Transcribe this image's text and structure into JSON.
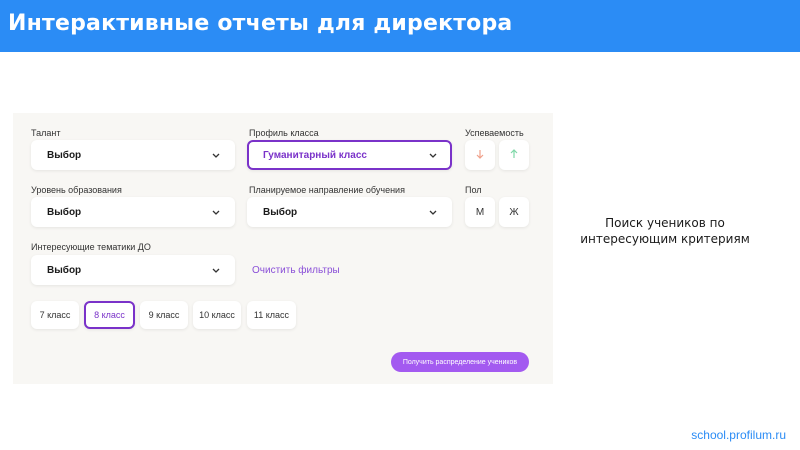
{
  "slide": {
    "title": "Интерактивные отчеты для директора",
    "caption_line1": "Поиск учеников по",
    "caption_line2": "интересующим критериям",
    "footer_url": "school.profilum.ru"
  },
  "colors": {
    "header": "#2b8cf5",
    "accent": "#7a32c9",
    "button": "#a35af0",
    "arrow_down": "#f0a08a",
    "arrow_up": "#7fd8a8"
  },
  "filters": {
    "talent": {
      "label": "Талант",
      "value": "Выбор"
    },
    "profile": {
      "label": "Профиль класса",
      "value": "Гуманитарный класс"
    },
    "performance": {
      "label": "Успеваемость",
      "down_icon": "arrow-down-icon",
      "up_icon": "arrow-up-icon"
    },
    "education_level": {
      "label": "Уровень образования",
      "value": "Выбор"
    },
    "direction": {
      "label": "Планируемое направление обучения",
      "value": "Выбор"
    },
    "gender": {
      "label": "Пол",
      "male": "М",
      "female": "Ж"
    },
    "topics": {
      "label": "Интересующие тематики ДО",
      "value": "Выбор"
    },
    "clear_label": "Очистить фильтры"
  },
  "grades": [
    {
      "label": "7 класс",
      "selected": false
    },
    {
      "label": "8 класс",
      "selected": true
    },
    {
      "label": "9 класс",
      "selected": false
    },
    {
      "label": "10 класс",
      "selected": false
    },
    {
      "label": "11 класс",
      "selected": false
    }
  ],
  "submit_label": "Получить распределение учеников"
}
